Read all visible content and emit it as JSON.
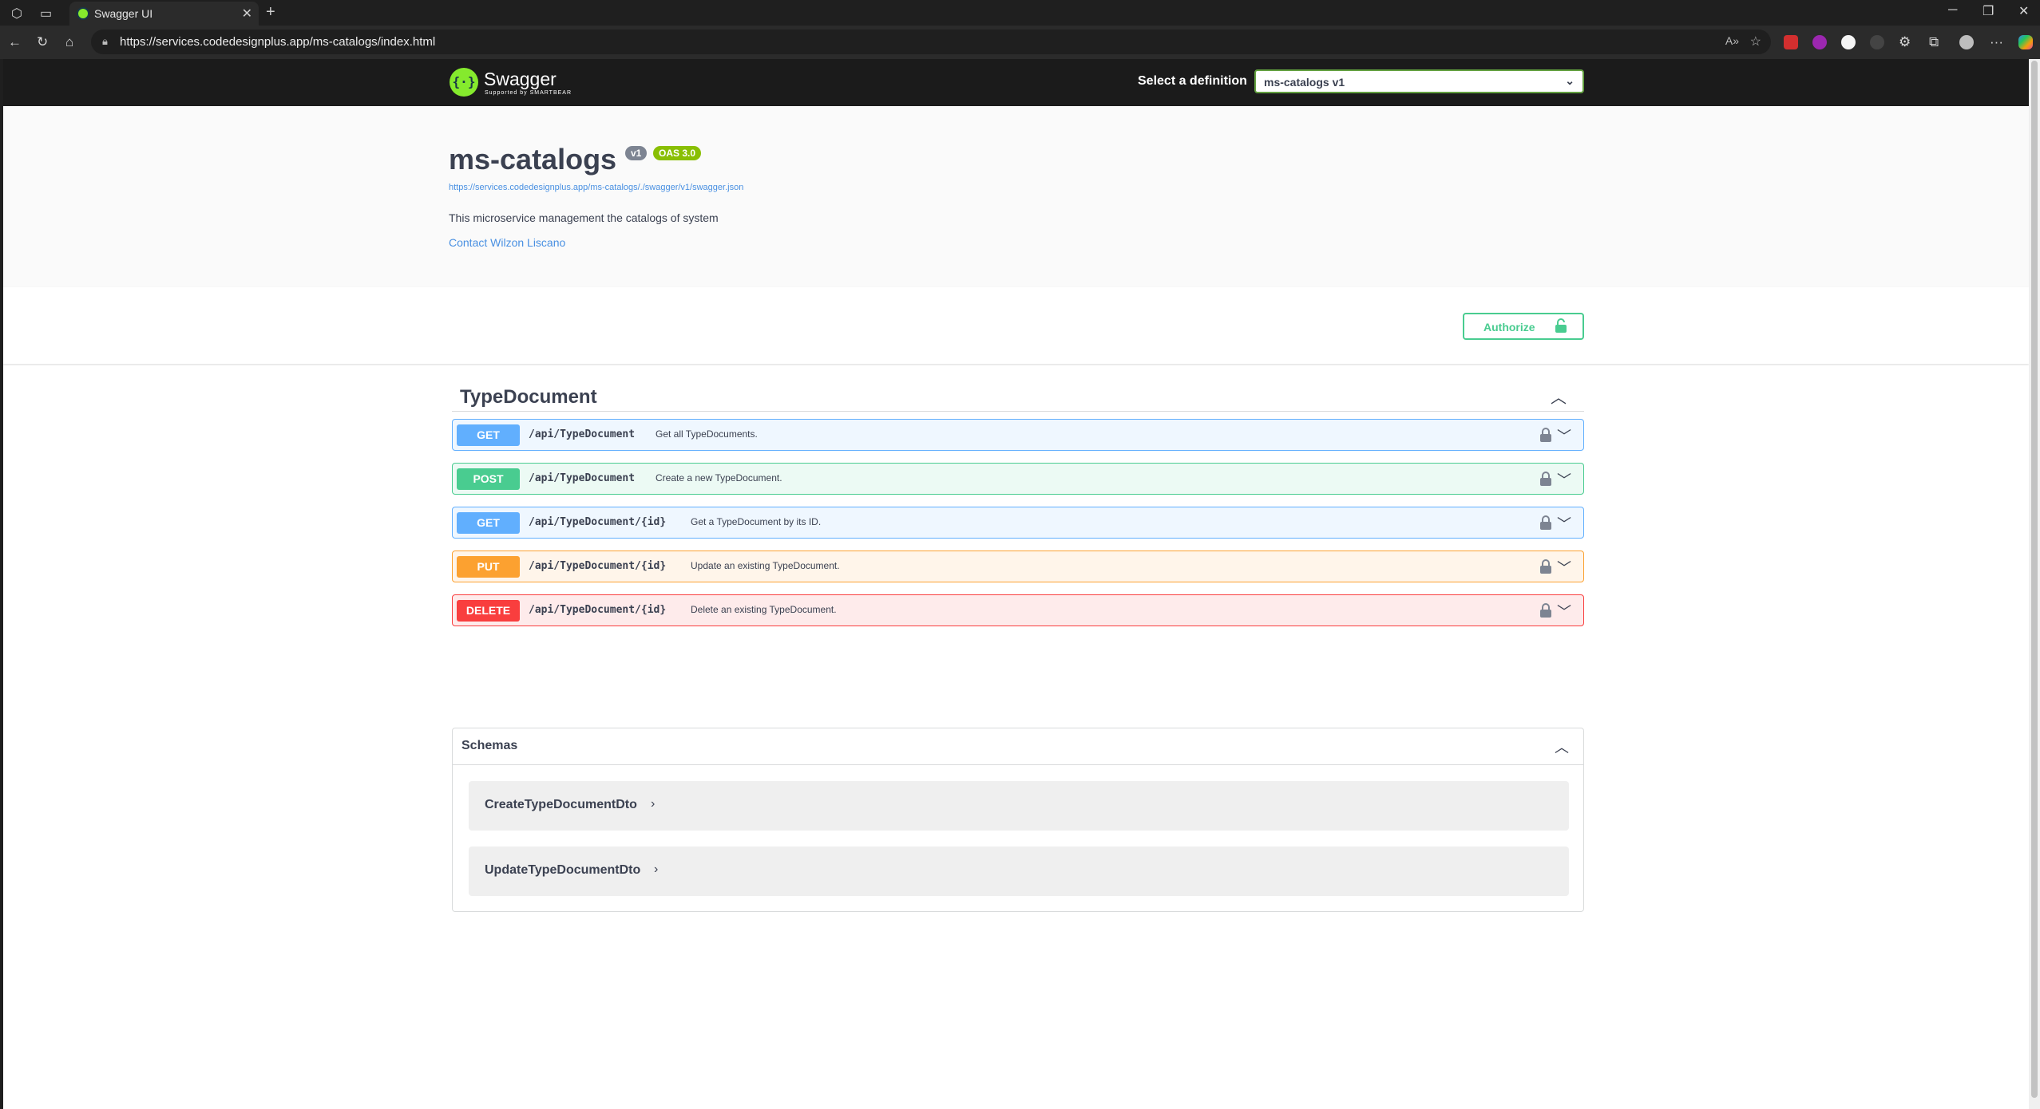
{
  "browser": {
    "tab_title": "Swagger UI",
    "url": "https://services.codedesignplus.app/ms-catalogs/index.html"
  },
  "topbar": {
    "brand": "Swagger",
    "brand_sub": "Supported by SMARTBEAR",
    "definition_label": "Select a definition",
    "definition_value": "ms-catalogs v1"
  },
  "info": {
    "title": "ms-catalogs",
    "version_badge": "v1",
    "oas_badge": "OAS 3.0",
    "spec_url": "https://services.codedesignplus.app/ms-catalogs/./swagger/v1/swagger.json",
    "description": "This microservice management the catalogs of system",
    "contact": "Contact Wilzon Liscano"
  },
  "authorize": {
    "label": "Authorize"
  },
  "tag": {
    "name": "TypeDocument"
  },
  "operations": [
    {
      "method": "GET",
      "path": "/api/TypeDocument",
      "summary": "Get all TypeDocuments."
    },
    {
      "method": "POST",
      "path": "/api/TypeDocument",
      "summary": "Create a new TypeDocument."
    },
    {
      "method": "GET",
      "path": "/api/TypeDocument/{id}",
      "summary": "Get a TypeDocument by its ID."
    },
    {
      "method": "PUT",
      "path": "/api/TypeDocument/{id}",
      "summary": "Update an existing TypeDocument."
    },
    {
      "method": "DELETE",
      "path": "/api/TypeDocument/{id}",
      "summary": "Delete an existing TypeDocument."
    }
  ],
  "schemas": {
    "title": "Schemas",
    "models": [
      "CreateTypeDocumentDto",
      "UpdateTypeDocumentDto"
    ]
  },
  "colors": {
    "get": "#61affe",
    "post": "#49cc90",
    "put": "#fca130",
    "delete": "#f93e3e",
    "swagger_green": "#85ea2d"
  }
}
